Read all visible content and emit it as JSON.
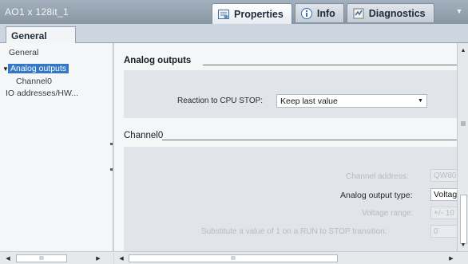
{
  "window": {
    "title": "AO1 x 128it_1"
  },
  "property_tabs": [
    {
      "label": "Properties",
      "icon": "properties-icon",
      "active": true
    },
    {
      "label": "Info",
      "icon": "info-icon",
      "active": false
    },
    {
      "label": "Diagnostics",
      "icon": "diagnostics-icon",
      "active": false
    }
  ],
  "general_tab": {
    "label": "General"
  },
  "nav": {
    "items": [
      {
        "label": "General"
      },
      {
        "label": "Analog outputs",
        "selected": true
      },
      {
        "label": "Channel0"
      },
      {
        "label": "IO addresses/HW..."
      }
    ]
  },
  "analog_outputs": {
    "title": "Analog outputs",
    "reaction_label": "Reaction to CPU STOP:",
    "reaction_value": "Keep last value"
  },
  "channel0": {
    "title": "Channel0",
    "address_label": "Channel address:",
    "address_value": "QW80",
    "output_type_label": "Analog output type:",
    "output_type_value": "Voltage",
    "voltage_range_label": "Voltage range:",
    "voltage_range_value": "+/- 10 V",
    "substitute_label": "Substitute a value of 1 on a RUN to STOP transition:",
    "substitute_value": "0"
  },
  "scrollbar": {
    "thumb_label": "III"
  },
  "colors": {
    "accent": "#3477c5",
    "titlebar": "#95a3b0",
    "section_bg": "#e1e4e8"
  }
}
